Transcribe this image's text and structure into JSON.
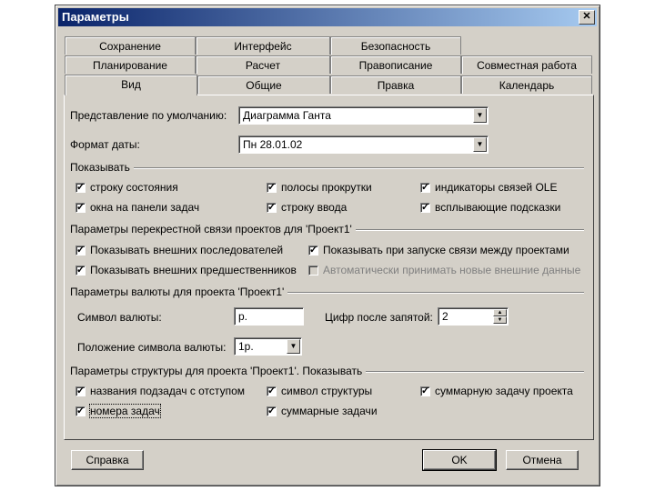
{
  "window": {
    "title": "Параметры",
    "close_glyph": "✕"
  },
  "tabs": {
    "row1": [
      "Сохранение",
      "Интерфейс",
      "Безопасность"
    ],
    "row2": [
      "Планирование",
      "Расчет",
      "Правописание",
      "Совместная работа"
    ],
    "row3": [
      "Вид",
      "Общие",
      "Правка",
      "Календарь"
    ],
    "active": "Вид"
  },
  "view": {
    "default_view_label": "Представление по умолчанию:",
    "default_view_value": "Диаграмма Ганта",
    "date_format_label": "Формат даты:",
    "date_format_value": "Пн 28.01.02"
  },
  "show": {
    "title": "Показывать",
    "items": [
      {
        "label": "строку состояния",
        "checked": true
      },
      {
        "label": "окна на панели задач",
        "checked": true
      },
      {
        "label": "полосы прокрутки",
        "checked": true
      },
      {
        "label": "строку ввода",
        "checked": true
      },
      {
        "label": "индикаторы связей OLE",
        "checked": true
      },
      {
        "label": "всплывающие подсказки",
        "checked": true
      }
    ]
  },
  "cross_project": {
    "title": "Параметры перекрестной связи проектов для 'Проект1'",
    "items": [
      {
        "label": "Показывать внешних последователей",
        "checked": true
      },
      {
        "label": "Показывать внешних предшественников",
        "checked": true
      },
      {
        "label": "Показывать при запуске связи между проектами",
        "checked": true
      },
      {
        "label": "Автоматически принимать новые внешние данные",
        "checked": false,
        "disabled": true
      }
    ]
  },
  "currency": {
    "title": "Параметры валюты для проекта 'Проект1'",
    "symbol_label": "Символ валюты:",
    "symbol_value": "р.",
    "decimals_label": "Цифр после запятой:",
    "decimals_value": "2",
    "position_label": "Положение символа валюты:",
    "position_value": "1р."
  },
  "outline": {
    "title": "Параметры структуры для проекта 'Проект1'. Показывать",
    "items": [
      {
        "label": "названия подзадач с отступом",
        "checked": true
      },
      {
        "label": "номера задач",
        "checked": true
      },
      {
        "label": "символ структуры",
        "checked": true
      },
      {
        "label": "суммарные задачи",
        "checked": true
      },
      {
        "label": "суммарную задачу проекта",
        "checked": true
      }
    ]
  },
  "buttons": {
    "help": "Справка",
    "ok": "OK",
    "cancel": "Отмена"
  },
  "glyphs": {
    "check": "✓",
    "dropdown": "▼",
    "spin_up": "▲",
    "spin_down": "▼"
  }
}
